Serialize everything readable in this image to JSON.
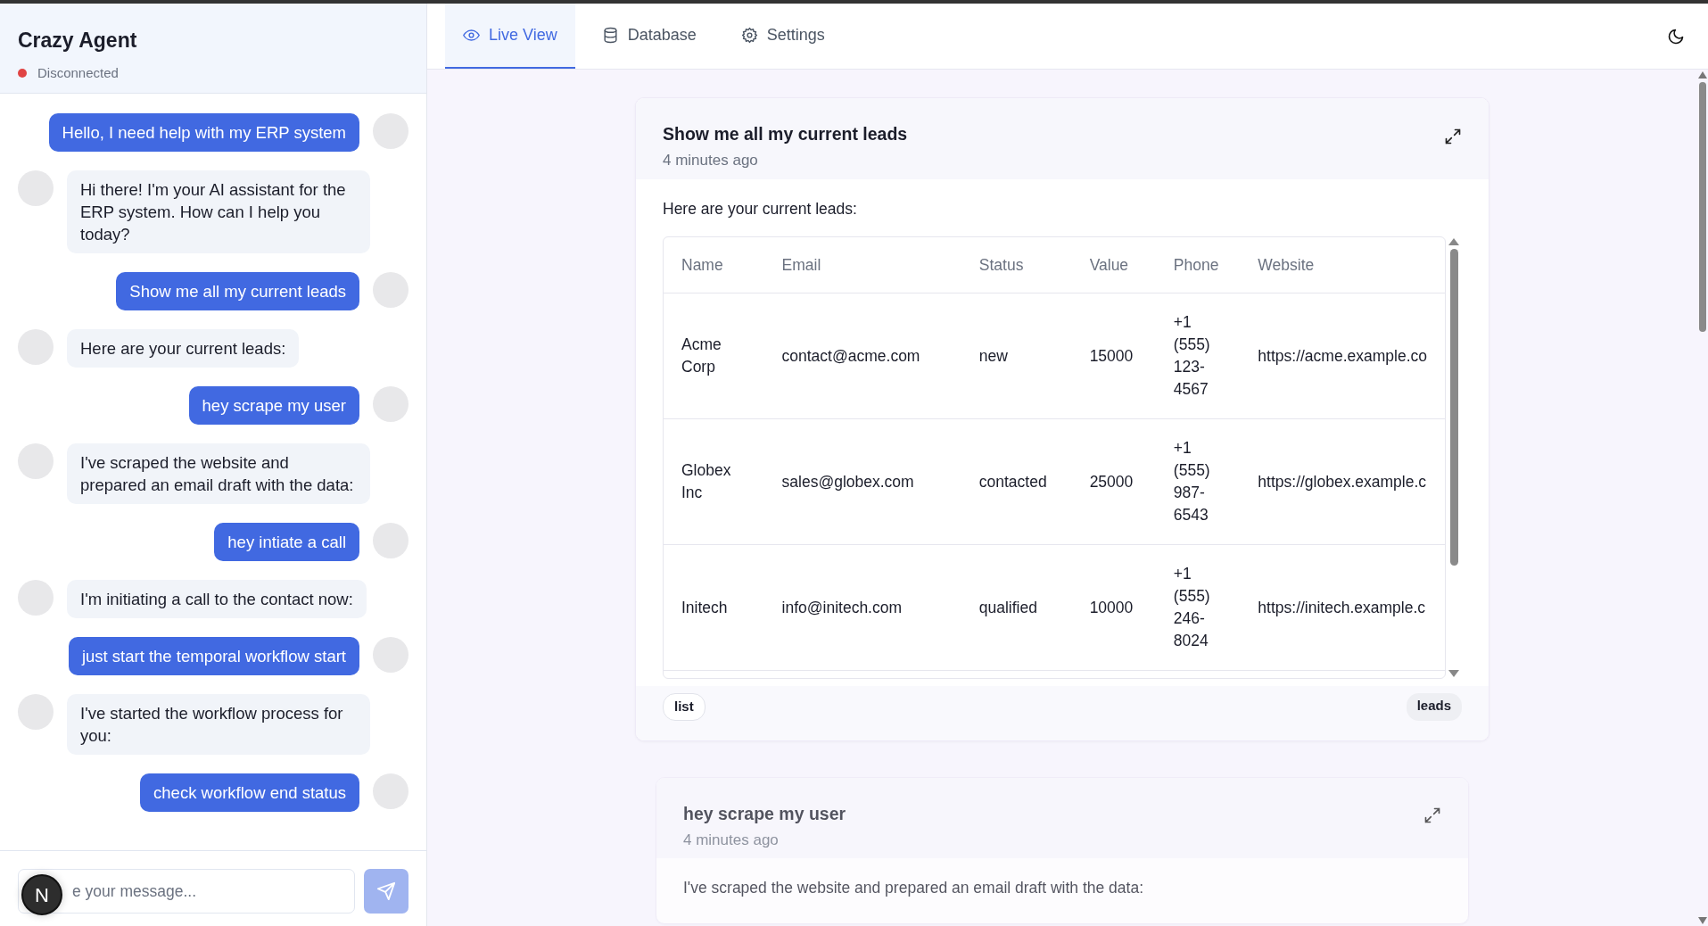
{
  "sidebar": {
    "title": "Crazy Agent",
    "status": {
      "label": "Disconnected",
      "connected": false
    }
  },
  "messages": [
    {
      "kind": "user",
      "text": "Hello, I need help with my ERP system"
    },
    {
      "kind": "assistant",
      "text": "Hi there! I'm your AI assistant for the ERP system. How can I help you today?"
    },
    {
      "kind": "user",
      "text": "Show me all my current leads"
    },
    {
      "kind": "assistant",
      "text": "Here are your current leads:"
    },
    {
      "kind": "user",
      "text": "hey scrape my user"
    },
    {
      "kind": "assistant",
      "text": "I've scraped the website and prepared an email draft with the data:"
    },
    {
      "kind": "user",
      "text": "hey intiate a call"
    },
    {
      "kind": "assistant",
      "text": "I'm initiating a call to the contact now:"
    },
    {
      "kind": "user",
      "text": "just start the temporal workflow start"
    },
    {
      "kind": "assistant",
      "text": "I've started the workflow process for you:"
    },
    {
      "kind": "user",
      "text": "check workflow end status"
    }
  ],
  "composer": {
    "placeholder": "e your message..."
  },
  "dev_badge": {
    "label": "N"
  },
  "tabs": [
    {
      "label": "Live View",
      "selected": true
    },
    {
      "label": "Database",
      "selected": false
    },
    {
      "label": "Settings",
      "selected": false
    }
  ],
  "cards": [
    {
      "title": "Show me all my current leads",
      "time": "4 minutes ago",
      "intro": "Here are your current leads:",
      "table": {
        "columns": [
          "Name",
          "Email",
          "Status",
          "Value",
          "Phone",
          "Website"
        ],
        "rows": [
          [
            "Acme Corp",
            "contact@acme.com",
            "new",
            "15000",
            "+1 (555) 123-4567",
            "https://acme.example.co"
          ],
          [
            "Globex Inc",
            "sales@globex.com",
            "contacted",
            "25000",
            "+1 (555) 987-6543",
            "https://globex.example.c"
          ],
          [
            "Initech",
            "info@initech.com",
            "qualified",
            "10000",
            "+1 (555) 246-8024",
            "https://initech.example.c"
          ]
        ]
      },
      "tags": [
        {
          "label": "list",
          "kind": "outline"
        },
        {
          "label": "leads",
          "kind": "filled"
        }
      ]
    },
    {
      "title": "hey scrape my user",
      "time": "4 minutes ago",
      "intro": "I've scraped the website and prepared an email draft with the data:"
    }
  ]
}
